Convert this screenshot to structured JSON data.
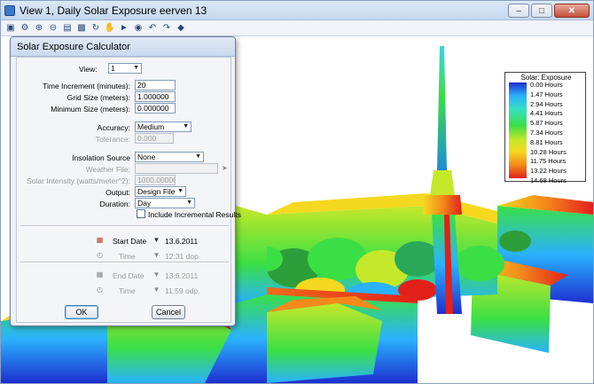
{
  "window": {
    "title": "View 1, Daily Solar Exposure eerven 13",
    "controls": [
      "minimize",
      "maximize",
      "close"
    ]
  },
  "toolbar": {
    "icons": [
      "view-attributes-icon",
      "levels-icon",
      "zoom-in-icon",
      "zoom-out-icon",
      "window-area-icon",
      "fit-view-icon",
      "rotate-view-icon",
      "pan-icon",
      "walk-icon",
      "camera-icon",
      "undo-view-icon",
      "redo-view-icon",
      "render-icon"
    ]
  },
  "legend": {
    "title": "Solar: Exposure",
    "labels": [
      "0.00 Hours",
      "1.47 Hours",
      "2.94 Hours",
      "4.41 Hours",
      "5.87 Hours",
      "7.34 Hours",
      "8.81 Hours",
      "10.28 Hours",
      "11.75 Hours",
      "13.22 Hours",
      "14.68 Hours"
    ]
  },
  "dialog": {
    "title": "Solar Exposure Calculator",
    "view_label": "View:",
    "view_value": "1",
    "time_increment_label": "Time Increment (minutes):",
    "time_increment_value": "20",
    "grid_size_label": "Grid Size (meters):",
    "grid_size_value": "1.000000",
    "min_size_label": "Minimum Size (meters):",
    "min_size_value": "0.000000",
    "accuracy_label": "Accuracy:",
    "accuracy_value": "Medium",
    "tolerance_label": "Tolerance:",
    "tolerance_value": "0.000",
    "insolation_label": "Insolation Source",
    "insolation_value": "None",
    "weather_label": "Weather File:",
    "weather_value": "",
    "intensity_label": "Solar Intensity (watts/meter^2):",
    "intensity_value": "1000.00000",
    "output_label": "Output:",
    "output_value": "Design File",
    "duration_label": "Duration:",
    "duration_value": "Day",
    "incremental_label": "Include Incremental Results",
    "start_date_label": "Start Date",
    "start_date_value": "13.6.2011",
    "start_time_label": "Time",
    "start_time_value": "12:31 dop.",
    "end_date_label": "End Date",
    "end_date_value": "13.6.2011",
    "end_time_label": "Time",
    "end_time_value": "11:59 odp.",
    "ok_label": "OK",
    "cancel_label": "Cancel"
  },
  "colors": {
    "legend_low": "#1e2fd0",
    "legend_mid": "#3adf45",
    "legend_high": "#e2201a"
  }
}
